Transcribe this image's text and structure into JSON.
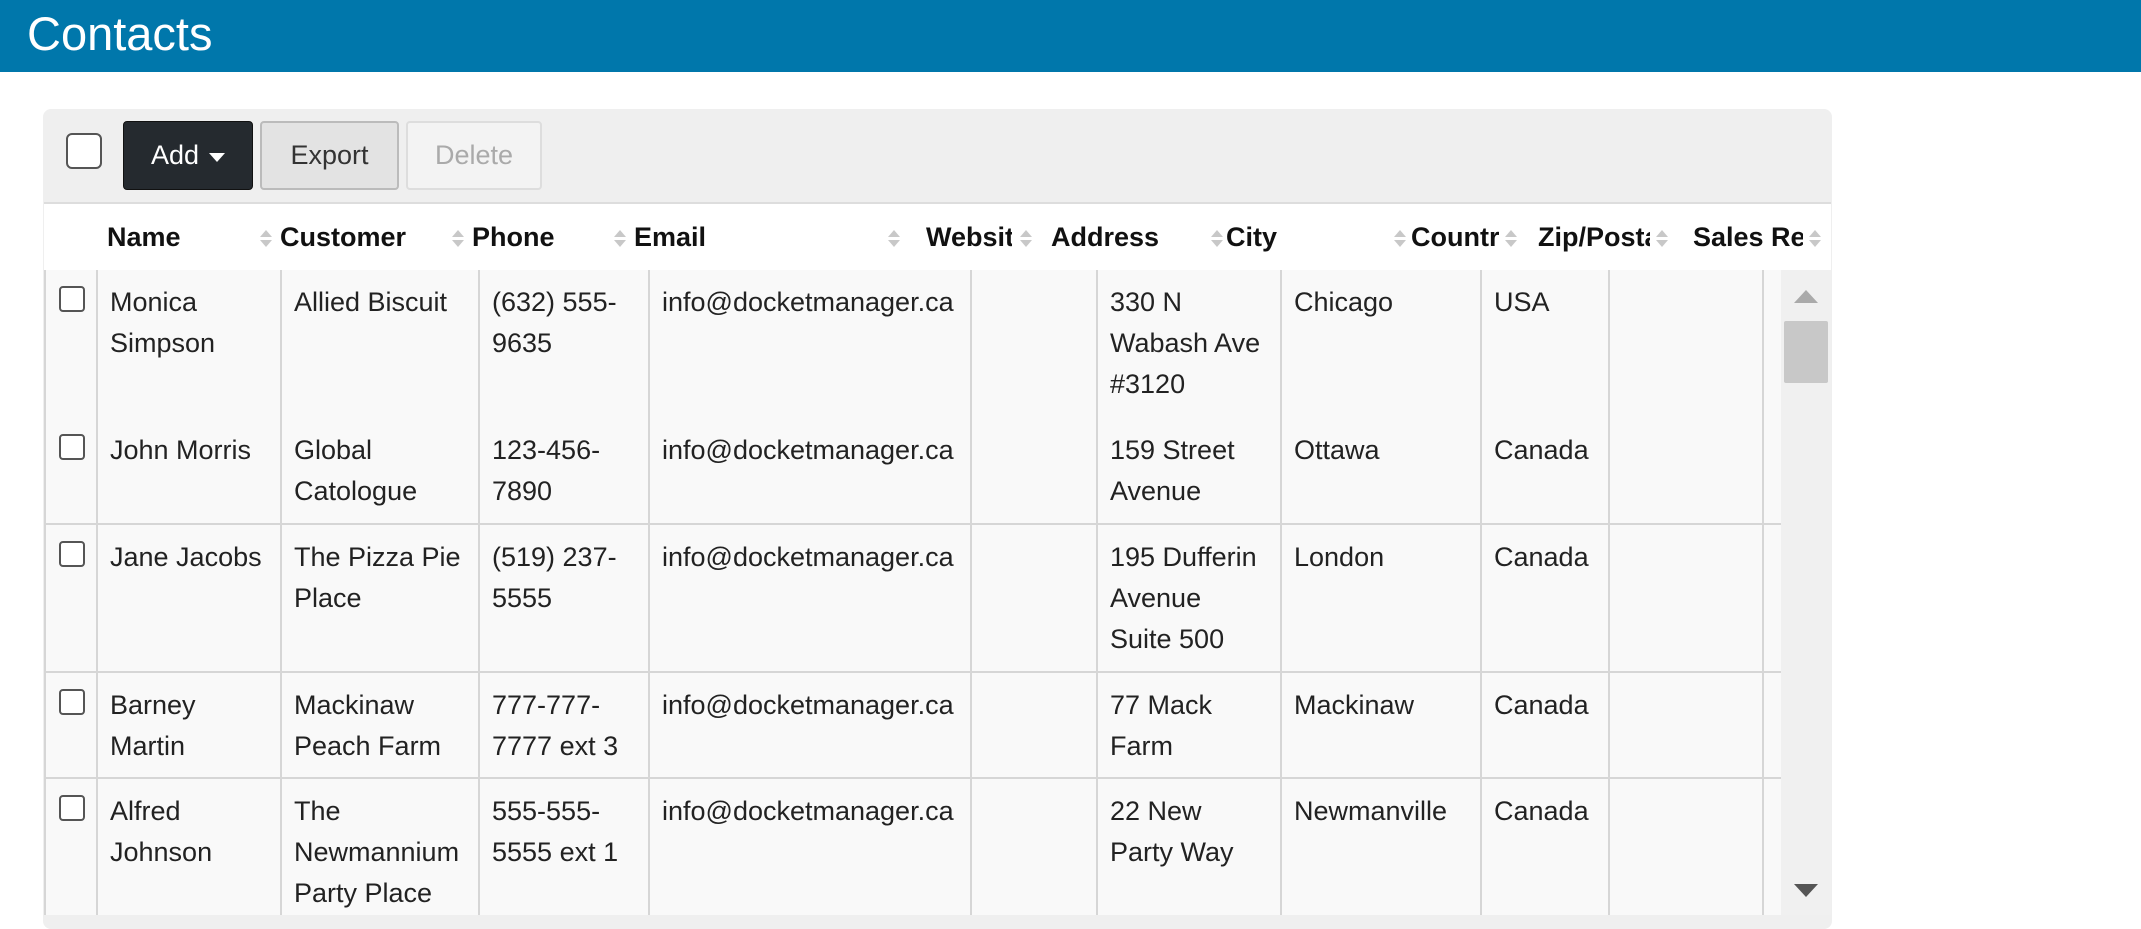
{
  "page": {
    "title": "Contacts"
  },
  "toolbar": {
    "add_label": "Add",
    "export_label": "Export",
    "delete_label": "Delete"
  },
  "columns": [
    "Name",
    "Customer",
    "Phone",
    "Email",
    "Websit",
    "Address",
    "City",
    "Countr",
    "Zip/Posta",
    "Sales Re"
  ],
  "rows": [
    {
      "name": "Monica Simpson",
      "customer": "Allied Biscuit",
      "phone": "(632) 555-9635",
      "email": "info@docketmanager.ca",
      "website": "",
      "address": "330 N Wabash Ave #3120",
      "city": "Chicago",
      "country": "USA",
      "zip": "",
      "sales_rep": ""
    },
    {
      "name": "John Morris",
      "customer": "Global Catologue",
      "phone": "123-456-7890",
      "email": "info@docketmanager.ca",
      "website": "",
      "address": "159 Street Avenue",
      "city": "Ottawa",
      "country": "Canada",
      "zip": "",
      "sales_rep": ""
    },
    {
      "name": "Jane Jacobs",
      "customer": "The Pizza Pie Place",
      "phone": "(519) 237-5555",
      "email": "info@docketmanager.ca",
      "website": "",
      "address": "195 Dufferin Avenue Suite 500",
      "city": "London",
      "country": "Canada",
      "zip": "",
      "sales_rep": ""
    },
    {
      "name": "Barney Martin",
      "customer": "Mackinaw Peach Farm",
      "phone": "777-777-7777 ext 3",
      "email": "info@docketmanager.ca",
      "website": "",
      "address": "77 Mack Farm",
      "city": "Mackinaw",
      "country": "Canada",
      "zip": "",
      "sales_rep": ""
    },
    {
      "name": "Alfred Johnson",
      "customer": "The Newmannium Party Place",
      "phone": "555-555-5555 ext 1",
      "email": "info@docketmanager.ca",
      "website": "",
      "address": "22 New Party Way",
      "city": "Newmanville",
      "country": "Canada",
      "zip": "",
      "sales_rep": ""
    }
  ]
}
